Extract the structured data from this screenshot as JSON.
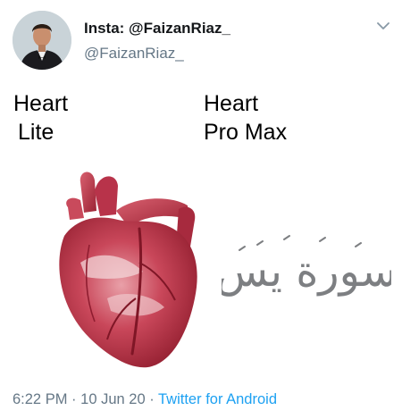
{
  "tweet": {
    "display_name": "Insta: @FaizanRiaz_",
    "handle": "@FaizanRiaz_",
    "menu_icon": "chevron-down-icon",
    "avatar_icon": "profile-photo"
  },
  "meme": {
    "left_line1": "Heart",
    "left_line2": "Lite",
    "right_line1": "Heart",
    "right_line2": "Pro Max",
    "calligraphy_text": "سورة يس",
    "heart_image": "anatomical-heart"
  },
  "footer": {
    "time": "6:22 PM",
    "separator": "·",
    "date": "10 Jun 20",
    "source": "Twitter for Android"
  },
  "colors": {
    "secondary_text": "#657786",
    "link": "#1da1f2",
    "heart_red": "#b3293b"
  }
}
